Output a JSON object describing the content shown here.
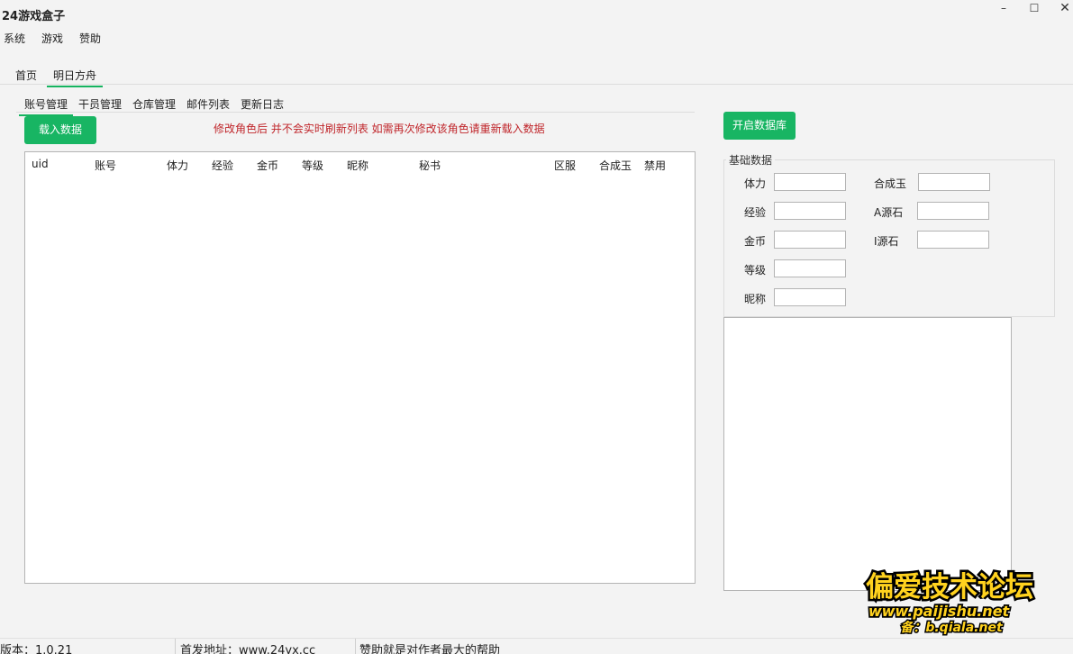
{
  "window": {
    "title": "24游戏盒子",
    "min": "–",
    "max": "☐",
    "close": "✕"
  },
  "menu": [
    "系统",
    "游戏",
    "赞助"
  ],
  "top_tabs": [
    "首页",
    "明日方舟"
  ],
  "sub_tabs": [
    "账号管理",
    "干员管理",
    "仓库管理",
    "邮件列表",
    "更新日志"
  ],
  "load_button": "载入数据",
  "warning": "修改角色后  并不会实时刷新列表  如需再次修改该角色请重新载入数据",
  "table": {
    "columns": [
      "uid",
      "账号",
      "体力",
      "经验",
      "金币",
      "等级",
      "昵称",
      "秘书",
      "区服",
      "合成玉",
      "禁用"
    ],
    "rows": []
  },
  "db_button": "开启数据库",
  "basic_group": {
    "title": "基础数据",
    "fields": [
      {
        "label": "体力",
        "value": ""
      },
      {
        "label": "经验",
        "value": ""
      },
      {
        "label": "金币",
        "value": ""
      },
      {
        "label": "等级",
        "value": ""
      },
      {
        "label": "昵称",
        "value": ""
      },
      {
        "label": "合成玉",
        "value": ""
      },
      {
        "label": "A源石",
        "value": ""
      },
      {
        "label": "I源石",
        "value": ""
      }
    ]
  },
  "log_text": "",
  "status": {
    "version": "版本：1.0.21",
    "site": "首发地址：www.24yx.cc",
    "thanks": "赞助就是对作者最大的帮助"
  },
  "watermark": {
    "line1": "偏爱技术论坛",
    "line2": "www.paijishu.net",
    "line3": "备：b.qiala.net"
  }
}
